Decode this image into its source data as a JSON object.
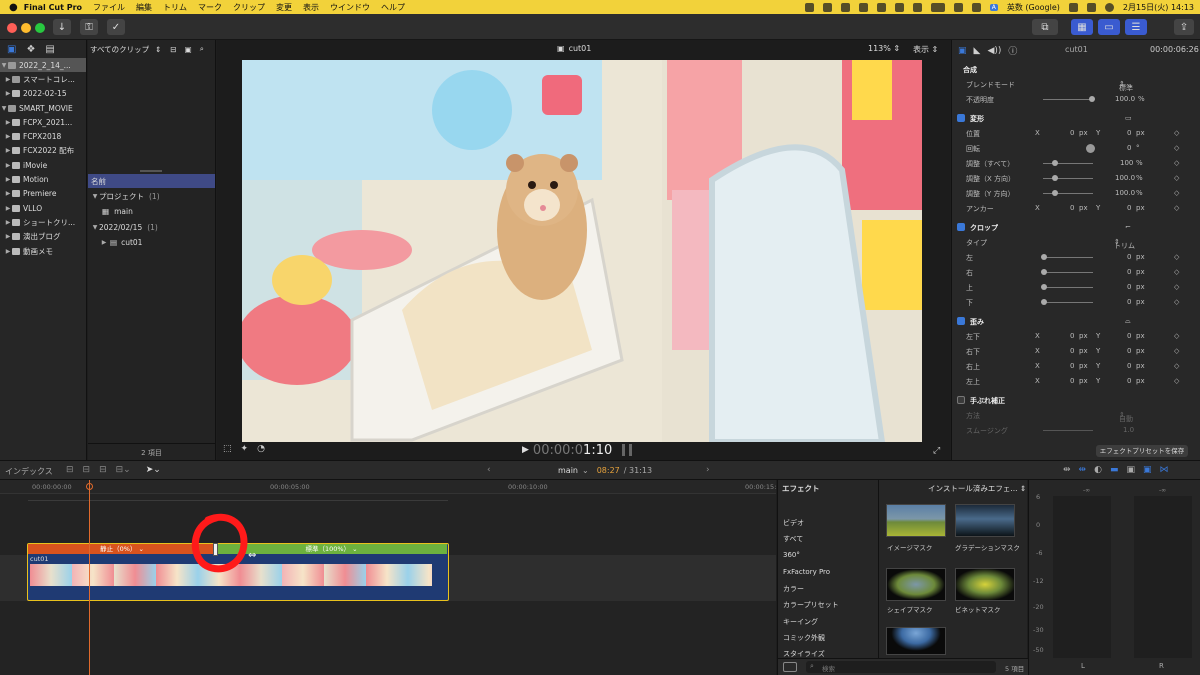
{
  "menubar": {
    "app": "Final Cut Pro",
    "items": [
      "ファイル",
      "編集",
      "トリム",
      "マーク",
      "クリップ",
      "変更",
      "表示",
      "ウインドウ",
      "ヘルプ"
    ],
    "input_source": "英数 (Google)",
    "datetime": "2月15日(火) 14:13"
  },
  "libraries": {
    "items": [
      {
        "label": "2022_2_14_..."
      },
      {
        "label": "スマートコレ..."
      },
      {
        "label": "2022-02-15"
      },
      {
        "label": "SMART_MOVIE"
      },
      {
        "label": "FCPX_2021..."
      },
      {
        "label": "FCPX2018"
      },
      {
        "label": "FCX2022 配布"
      },
      {
        "label": "iMovie"
      },
      {
        "label": "Motion"
      },
      {
        "label": "Premiere"
      },
      {
        "label": "VLLO"
      },
      {
        "label": "ショートクリ..."
      },
      {
        "label": "演出ブログ"
      },
      {
        "label": "動画メモ"
      }
    ]
  },
  "browser": {
    "filter": "すべてのクリップ",
    "col_name": "名前",
    "projects_label": "プロジェクト",
    "projects_count": "(1)",
    "project_item": "main",
    "date_group": "2022/02/15",
    "date_count": "(1)",
    "clip_item": "cut01",
    "count": "2 項目"
  },
  "viewer": {
    "title": "cut01",
    "zoom": "113%",
    "view_label": "表示",
    "timecode_dim": "00:00:0",
    "timecode_bright": "1:10"
  },
  "inspector": {
    "title": "cut01",
    "duration": "00:00:06:26",
    "composite": "合成",
    "blend_label": "ブレンドモード",
    "blend_value": "標準",
    "opacity_label": "不透明度",
    "opacity_value": "100.0",
    "pct": "%",
    "px": "px",
    "x": "X",
    "y": "Y",
    "transform": "変形",
    "position_label": "位置",
    "pos_x": "0",
    "pos_y": "0",
    "rotation_label": "回転",
    "rotation_value": "0",
    "deg": "°",
    "scale_all_label": "調整（すべて）",
    "scale_all": "100",
    "scale_x_label": "調整（X 方向）",
    "scale_x": "100.0",
    "scale_y_label": "調整（Y 方向）",
    "scale_y": "100.0",
    "anchor_label": "アンカー",
    "anchor_x": "0",
    "anchor_y": "0",
    "crop": "クロップ",
    "type_label": "タイプ",
    "type_value": "トリム",
    "left": "左",
    "right": "右",
    "top": "上",
    "bottom": "下",
    "zero": "0",
    "distort": "歪み",
    "bl": "左下",
    "br": "右下",
    "tr": "右上",
    "tl": "左上",
    "stabilize": "手ぶれ補正",
    "method_label": "方法",
    "method_value": "自動",
    "smoothing_label": "スムージング",
    "smoothing_value": "1.0",
    "save_preset": "エフェクトプリセットを保存"
  },
  "timeline": {
    "index_label": "インデックス",
    "project": "main",
    "time_current": "08:27",
    "time_total": "/ 31:13",
    "ruler": [
      "00:00:00:00",
      "00:00:05:00",
      "00:00:10:00",
      "00:00:15:"
    ],
    "speed_hold": "静止（0%）",
    "speed_normal": "標準（100%）",
    "clip_name": "cut01"
  },
  "effects": {
    "title": "エフェクト",
    "installed": "インストール済みエフェ...",
    "categories": [
      "ビデオ",
      "すべて",
      "360°",
      "FxFactory Pro",
      "カラー",
      "カラープリセット",
      "キーイング",
      "コミック外観",
      "スタイライズ"
    ],
    "thumbs": [
      "イメージマスク",
      "グラデーションマスク",
      "シェイプマスク",
      "ビネットマスク"
    ],
    "search_placeholder": "検索",
    "count": "5 項目"
  },
  "meters": {
    "top_label": "-∞",
    "scale": [
      "6",
      "0",
      "-6",
      "-12",
      "-20",
      "-30",
      "-50"
    ],
    "left": "L",
    "right": "R"
  },
  "colors": {
    "accent_blue": "#3a78d8",
    "hold_bar": "#d9531e",
    "normal_bar": "#6db23e",
    "playhead": "#e06a2c",
    "annotation": "#ff1a1a"
  }
}
